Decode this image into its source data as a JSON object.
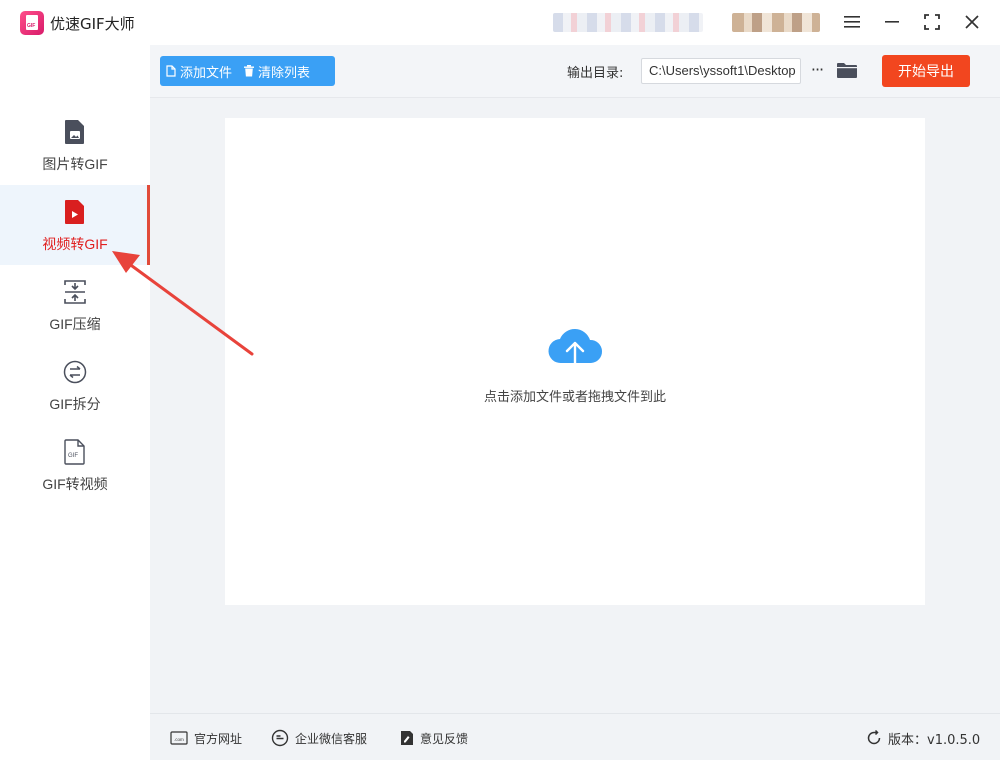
{
  "window": {
    "title": "优速GIF大师",
    "logo_text": "GIF"
  },
  "sidebar": {
    "items": [
      {
        "label": "图片转GIF",
        "icon": "image-file-icon",
        "active": false
      },
      {
        "label": "视频转GIF",
        "icon": "video-file-icon",
        "active": true
      },
      {
        "label": "GIF压缩",
        "icon": "compress-icon",
        "active": false
      },
      {
        "label": "GIF拆分",
        "icon": "split-icon",
        "active": false
      },
      {
        "label": "GIF转视频",
        "icon": "gif-file-icon",
        "active": false
      }
    ]
  },
  "toolbar": {
    "add_file_label": "添加文件",
    "clear_list_label": "清除列表",
    "output_label": "输出目录:",
    "output_path": "C:\\Users\\yssoft1\\Desktop",
    "more_label": "···",
    "start_label": "开始导出"
  },
  "drop_zone": {
    "hint": "点击添加文件或者拖拽文件到此"
  },
  "footer": {
    "website_label": "官方网址",
    "wechat_label": "企业微信客服",
    "feedback_label": "意见反馈",
    "version_label": "版本：v1.0.5.0"
  },
  "colors": {
    "accent_blue": "#3aa0f5",
    "start_red": "#f2461f",
    "active_red": "#e02020",
    "annotation_arrow": "#e8433b"
  }
}
